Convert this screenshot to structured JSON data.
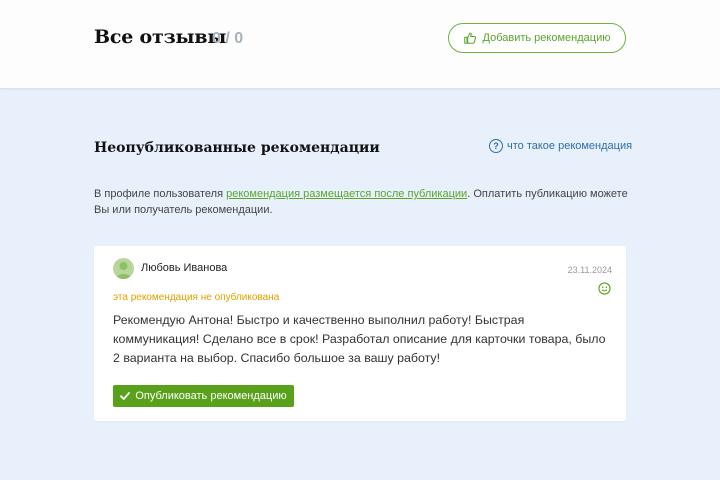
{
  "header": {
    "title": "Все отзывы",
    "count": "0 / 0",
    "add_button_label": "Добавить рекомендацию"
  },
  "section": {
    "title": "Неопубликованные рекомендации",
    "what_link": "что такое рекомендация",
    "info_prefix": "В профиле пользователя ",
    "info_link": "рекомендация размещается после публикации",
    "info_suffix": ". Оплатить публикацию можете Вы или получатель рекомендации."
  },
  "review": {
    "author": "Любовь Иванова",
    "date": "23.11.2024",
    "status": "эта рекомендация не опубликована",
    "text": "Рекомендую Антона! Быстро и качественно выполнил работу! Быстрая коммуникация! Сделано все в срок! Разработал описание для карточки товара, было 2 варианта на выбор. Спасибо большое за вашу работу!",
    "publish_button_label": "Опубликовать рекомендацию",
    "smile_icon": "smile-icon"
  },
  "colors": {
    "accent_green": "#5aa11b",
    "status_orange": "#e0a100",
    "link_blue": "#2e6ea8",
    "page_bg": "#e8f0fb"
  }
}
